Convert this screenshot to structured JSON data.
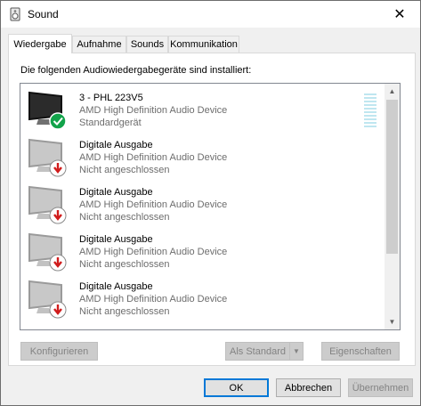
{
  "window": {
    "title": "Sound",
    "close_glyph": "✕"
  },
  "tabs": [
    {
      "label": "Wiedergabe",
      "active": true
    },
    {
      "label": "Aufnahme",
      "active": false
    },
    {
      "label": "Sounds",
      "active": false
    },
    {
      "label": "Kommunikation",
      "active": false
    }
  ],
  "panel": {
    "heading": "Die folgenden Audiowiedergabegeräte sind installiert:"
  },
  "devices": [
    {
      "name": "3 - PHL 223V5",
      "driver": "AMD High Definition Audio Device",
      "status": "Standardgerät",
      "badge": "default-check-icon"
    },
    {
      "name": "Digitale Ausgabe",
      "driver": "AMD High Definition Audio Device",
      "status": "Nicht angeschlossen",
      "badge": "disconnected-arrow-icon"
    },
    {
      "name": "Digitale Ausgabe",
      "driver": "AMD High Definition Audio Device",
      "status": "Nicht angeschlossen",
      "badge": "disconnected-arrow-icon"
    },
    {
      "name": "Digitale Ausgabe",
      "driver": "AMD High Definition Audio Device",
      "status": "Nicht angeschlossen",
      "badge": "disconnected-arrow-icon"
    },
    {
      "name": "Digitale Ausgabe",
      "driver": "AMD High Definition Audio Device",
      "status": "Nicht angeschlossen",
      "badge": "disconnected-arrow-icon"
    }
  ],
  "actions": {
    "configure": "Konfigurieren",
    "set_default": "Als Standard",
    "properties": "Eigenschaften"
  },
  "footer": {
    "ok": "OK",
    "cancel": "Abbrechen",
    "apply": "Übernehmen"
  },
  "colors": {
    "check_green": "#12a34a",
    "arrow_red": "#d01c1c",
    "accent": "#0078d7"
  }
}
